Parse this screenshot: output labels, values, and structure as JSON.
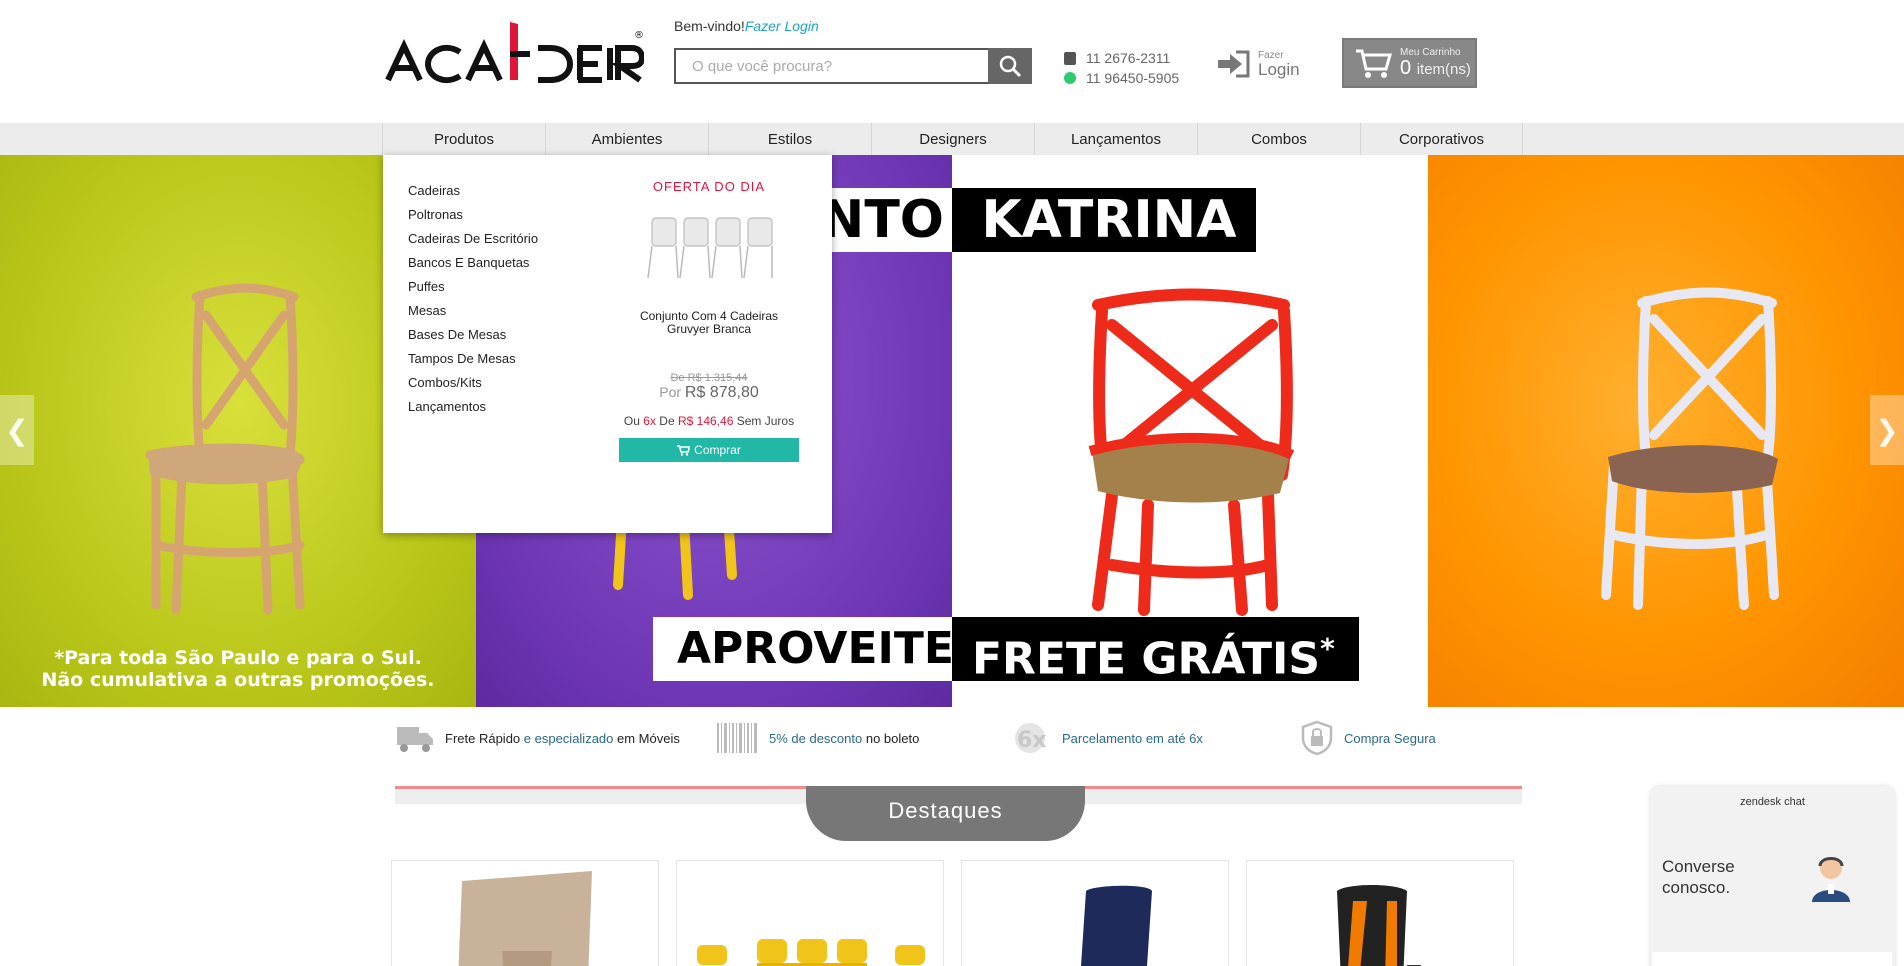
{
  "header": {
    "logo_text": "ACADEIRA",
    "welcome": "Bem-vindo!",
    "welcome_link": "Fazer Login",
    "search_placeholder": "O que você procura?",
    "phone": "11 2676-2311",
    "whatsapp": "11 96450-5905",
    "login_small": "Fazer",
    "login_big": "Login",
    "cart_title": "Meu Carrinho",
    "cart_count": "0",
    "cart_unit": "item(ns)"
  },
  "nav": [
    "Produtos",
    "Ambientes",
    "Estilos",
    "Designers",
    "Lançamentos",
    "Combos",
    "Corporativos"
  ],
  "dropdown": {
    "categories": [
      "Cadeiras",
      "Poltronas",
      "Cadeiras De Escritório",
      "Bancos E Banquetas",
      "Puffes",
      "Mesas",
      "Bases De Mesas",
      "Tampos De Mesas",
      "Combos/Kits",
      "Lançamentos"
    ],
    "offer_title": "OFERTA DO DIA",
    "product_name": "Conjunto Com 4 Cadeiras Gruvyer Branca",
    "old_label": "De",
    "old_price": "R$ 1.315,44",
    "new_label": "Por",
    "new_price": "R$ 878,80",
    "inst_prefix": "Ou",
    "inst_count": "6x",
    "inst_mid": "De",
    "inst_value": "R$ 146,46",
    "inst_suffix": "Sem Juros",
    "buy_label": "Comprar"
  },
  "banner": {
    "top_tag_partial": "NTO",
    "top_tag": "KATRINA",
    "tag_a": "APROVEITE",
    "tag_b": "FRETE GRÁTIS",
    "tag_b_mark": "*",
    "note_line1": "*Para toda São Paulo e para o Sul.",
    "note_line2": "Não cumulativa a outras promoções."
  },
  "features": [
    {
      "a": "Frete Rápido",
      "b": " e especializado ",
      "c": "em Móveis"
    },
    {
      "a": "5% de desconto",
      "b": " no boleto",
      "c": ""
    },
    {
      "a": "Parcelamento em até 6x",
      "b": "",
      "c": ""
    },
    {
      "a": "Compra Segura",
      "b": "",
      "c": ""
    }
  ],
  "section_title": "Destaques",
  "chat": {
    "title": "zendesk chat",
    "message": "Converse conosco."
  },
  "colors": {
    "accent_red": "#e0153a",
    "teal": "#21b8a7",
    "link": "#1aa6c9"
  }
}
